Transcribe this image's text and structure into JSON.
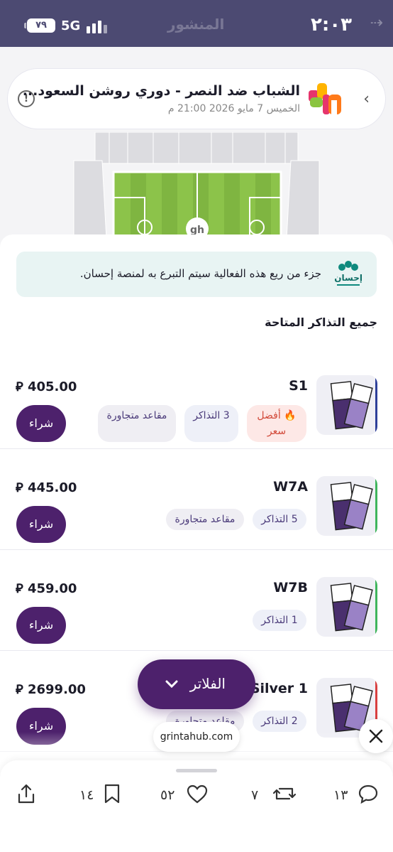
{
  "status_bar": {
    "time": "٢:٠٣",
    "network": "5G",
    "battery": "٧٩",
    "faded_title": "المنشور"
  },
  "event": {
    "title": "الشباب ضد النصر - دوري روشن السعود...",
    "date": "الخميس 7 مايو 2026 21:00 م"
  },
  "banner": {
    "text": "جزء من ريع هذه الفعالية سيتم التبرع به لمنصة إحسان.",
    "logo_name": "إحسان"
  },
  "section_title": "جميع التذاكر المتاحة",
  "tickets": [
    {
      "section": "S1",
      "price": "405.00",
      "buy": "شراء",
      "stripe": "#2d3f99",
      "tags": [
        {
          "text": "🔥 أفضل سعر",
          "style": "red"
        },
        {
          "text": "3 التذاكر",
          "style": "blue"
        },
        {
          "text": "مقاعد متجاورة",
          "style": "grey"
        }
      ]
    },
    {
      "section": "W7A",
      "price": "445.00",
      "buy": "شراء",
      "stripe": "#3fb55c",
      "tags": [
        {
          "text": "5 التذاكر",
          "style": "blue"
        },
        {
          "text": "مقاعد متجاورة",
          "style": "grey"
        }
      ]
    },
    {
      "section": "W7B",
      "price": "459.00",
      "buy": "شراء",
      "stripe": "#3fb55c",
      "tags": [
        {
          "text": "1 التذاكر",
          "style": "blue"
        }
      ]
    },
    {
      "section": "Silver 1",
      "price": "2699.00",
      "buy": "شراء",
      "stripe": "#d94040",
      "tags": [
        {
          "text": "2 التذاكر",
          "style": "blue"
        },
        {
          "text": "مقاعد متجاورة",
          "style": "grey"
        }
      ]
    }
  ],
  "filter_label": "الفلاتر",
  "url": "grintahub.com",
  "actions": {
    "replies": "١٣",
    "reposts": "٧",
    "likes": "٥٢",
    "bookmarks": "١٤"
  },
  "colors": {
    "primary": "#4d216c",
    "status_bar": "#4c4a72",
    "banner_bg": "#e8f4f3"
  }
}
